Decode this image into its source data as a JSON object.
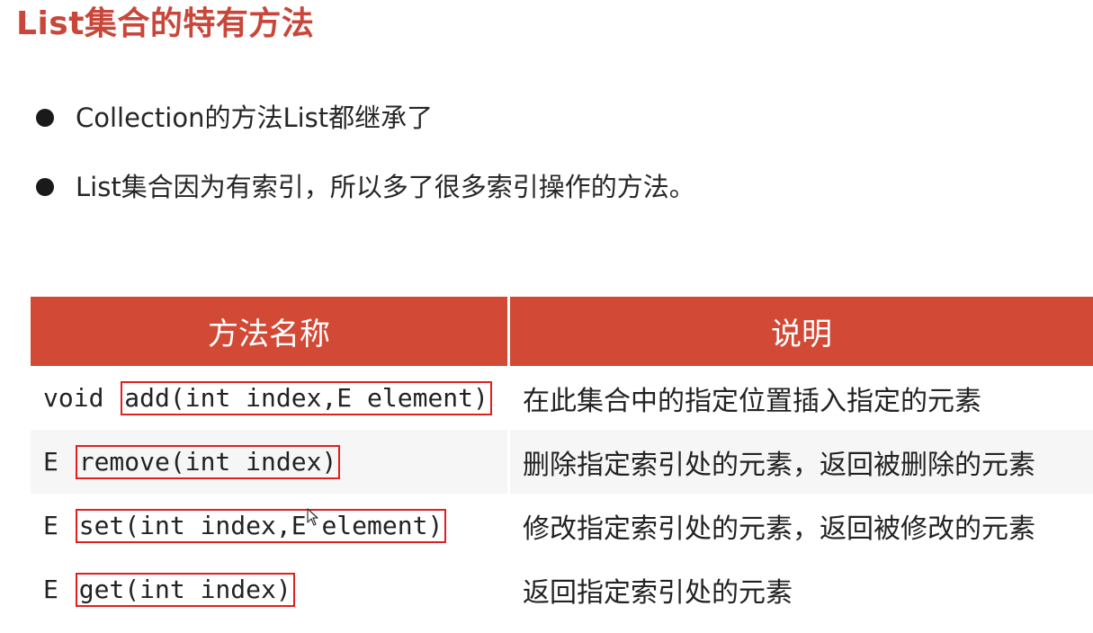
{
  "title": "List集合的特有方法",
  "bullets": [
    "Collection的方法List都继承了",
    "List集合因为有索引，所以多了很多索引操作的方法。"
  ],
  "table": {
    "headers": {
      "name": "方法名称",
      "desc": "说明"
    },
    "rows": [
      {
        "return_type": "void",
        "signature": "add(int index,E element)",
        "description": "在此集合中的指定位置插入指定的元素"
      },
      {
        "return_type": "E",
        "signature": "remove(int index)",
        "description": "删除指定索引处的元素，返回被删除的元素"
      },
      {
        "return_type": "E",
        "signature": "set(int index,E element)",
        "description": "修改指定索引处的元素，返回被修改的元素"
      },
      {
        "return_type": "E",
        "signature": "get(int index)",
        "description": "返回指定索引处的元素"
      }
    ]
  },
  "colors": {
    "title": "#c8463a",
    "header_bg": "#d24a35",
    "highlight_box": "#e02020"
  },
  "icons": {
    "bullet": "bullet-dot-icon",
    "cursor": "mouse-cursor-icon"
  }
}
